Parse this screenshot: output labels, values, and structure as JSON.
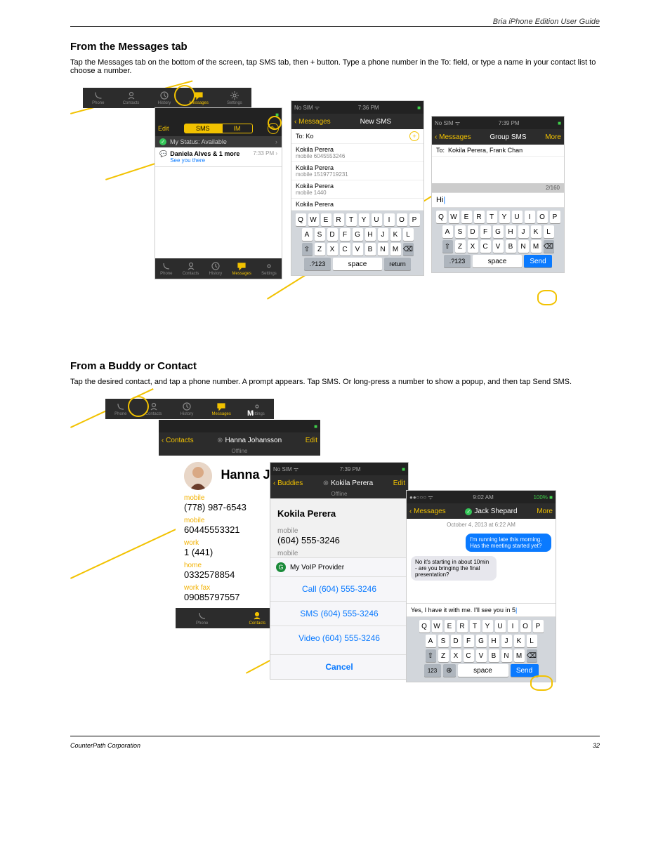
{
  "header_right": "Bria iPhone Edition User Guide",
  "sec1": {
    "heading": "From the Messages tab",
    "body": "Tap the Messages tab on the bottom of the screen, tap SMS tab, then + button. Type a phone number in the To: field, or type a name in your contact list to choose a number."
  },
  "sec2": {
    "heading": "From a Buddy or Contact",
    "body": "Tap the desired contact, and tap a phone number. A prompt appears. Tap SMS. Or long-press a number to show a popup, and then tap Send SMS."
  },
  "footer_left": "CounterPath Corporation",
  "footer_right": "32",
  "tabs": {
    "phone": "Phone",
    "contacts": "Contacts",
    "history": "History",
    "messages": "Messages",
    "settings": "Settings",
    "m_suffix": "M"
  },
  "screen1": {
    "edit": "Edit",
    "sms": "SMS",
    "im": "IM",
    "status": "My Status: Available",
    "conv_name": "Daniela Alves & 1 more",
    "conv_preview": "See you there",
    "conv_time": "7:33 PM"
  },
  "screen2": {
    "status_left": "No SIM",
    "time": "7:36 PM",
    "back": "Messages",
    "title": "New SMS",
    "to": "To:",
    "to_val": "Ko",
    "results": [
      {
        "name": "Kokila Perera",
        "sub": "mobile  6045553246"
      },
      {
        "name": "Kokila Perera",
        "sub": "mobile  15197719231"
      },
      {
        "name": "Kokila Perera",
        "sub": "mobile  1440"
      },
      {
        "name": "Kokila Perera",
        "sub": ""
      }
    ]
  },
  "screen3": {
    "status_left": "No SIM",
    "time": "7:39 PM",
    "back": "Messages",
    "title": "Group SMS",
    "more": "More",
    "to": "To:",
    "to_val": "Kokila Perera, Frank Chan",
    "count": "2/160",
    "input": "Hi"
  },
  "contact_header": {
    "back": "Contacts",
    "name": "Hanna Johansson",
    "sub": "Offline",
    "edit": "Edit"
  },
  "contact_detail": {
    "name": "Hanna Joh",
    "rows": [
      {
        "lbl": "mobile",
        "val": "(778) 987-6543"
      },
      {
        "lbl": "mobile",
        "val": "60445553321"
      },
      {
        "lbl": "work",
        "val": "1 (441)"
      },
      {
        "lbl": "home",
        "val": "0332578854"
      },
      {
        "lbl": "work fax",
        "val": "09085797557"
      }
    ]
  },
  "screen4": {
    "status_left": "No SIM",
    "time": "7:39 PM",
    "back": "Buddies",
    "title": "Kokila Perera",
    "sub": "Offline",
    "edit": "Edit",
    "body_name": "Kokila Perera",
    "lbl": "mobile",
    "num": "(604) 555-3246",
    "lbl2": "mobile",
    "provider": "My VoIP Provider",
    "call": "Call (604) 555-3246",
    "sms": "SMS (604) 555-3246",
    "video": "Video (604) 555-3246",
    "cancel": "Cancel"
  },
  "screen5": {
    "time": "9:02 AM",
    "batt": "100%",
    "back": "Messages",
    "title": "Jack Shepard",
    "more": "More",
    "date": "October 4, 2013 at 6:22 AM",
    "m1": "I'm running late this morning. Has the meeting started yet?",
    "m2": "No it's starting in about 10min - are you bringing the final presentation?",
    "input": "Yes, I have it with me. I'll see you in 5"
  },
  "kbd": {
    "r1": [
      "Q",
      "W",
      "E",
      "R",
      "T",
      "Y",
      "U",
      "I",
      "O",
      "P"
    ],
    "r2": [
      "A",
      "S",
      "D",
      "F",
      "G",
      "H",
      "J",
      "K",
      "L"
    ],
    "r3": [
      "Z",
      "X",
      "C",
      "V",
      "B",
      "N",
      "M"
    ],
    "num": ".?123",
    "num2": "123",
    "space": "space",
    "ret": "return",
    "send": "Send"
  }
}
